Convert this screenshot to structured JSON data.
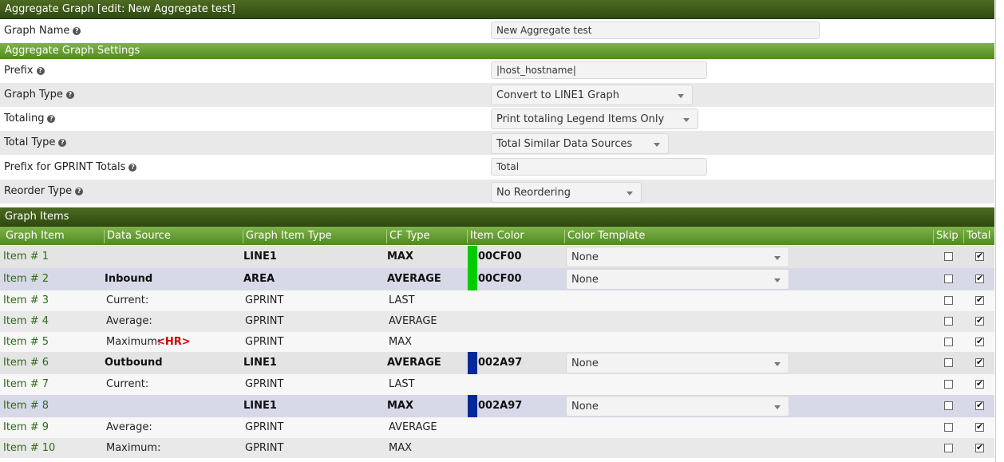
{
  "header": {
    "title": "Aggregate Graph [edit: New Aggregate test]"
  },
  "graph_name": {
    "label": "Graph Name",
    "value": "New Aggregate test"
  },
  "settings": {
    "title": "Aggregate Graph Settings",
    "prefix": {
      "label": "Prefix",
      "value": "|host_hostname|"
    },
    "graph_type": {
      "label": "Graph Type",
      "value": "Convert to LINE1 Graph"
    },
    "totaling": {
      "label": "Totaling",
      "value": "Print totaling Legend Items Only"
    },
    "total_type": {
      "label": "Total Type",
      "value": "Total Similar Data Sources"
    },
    "gprint_prefix": {
      "label": "Prefix for GPRINT Totals",
      "value": "Total"
    },
    "reorder_type": {
      "label": "Reorder Type",
      "value": "No Reordering"
    }
  },
  "items_section": {
    "title": "Graph Items",
    "columns": [
      "Graph Item",
      "Data Source",
      "Graph Item Type",
      "CF Type",
      "Item Color",
      "Color Template",
      "Skip",
      "Total"
    ],
    "rows": [
      {
        "name": "Item # 1",
        "source": "",
        "type": "LINE1",
        "cf": "MAX",
        "color": "00CF00",
        "swatch": "#00cc00",
        "template": "None",
        "skip": false,
        "total": true
      },
      {
        "name": "Item # 2",
        "source": "Inbound",
        "type": "AREA",
        "cf": "AVERAGE",
        "color": "00CF00",
        "swatch": "#00cc00",
        "template": "None",
        "skip": false,
        "total": true
      },
      {
        "name": "Item # 3",
        "source": "Current:",
        "type": "GPRINT",
        "cf": "LAST",
        "skip": false,
        "total": true
      },
      {
        "name": "Item # 4",
        "source": "Average:",
        "type": "GPRINT",
        "cf": "AVERAGE",
        "skip": false,
        "total": true
      },
      {
        "name": "Item # 5",
        "source": "Maximum:",
        "source_extra": "<HR>",
        "type": "GPRINT",
        "cf": "MAX",
        "skip": false,
        "total": true
      },
      {
        "name": "Item # 6",
        "source": "Outbound",
        "type": "LINE1",
        "cf": "AVERAGE",
        "color": "002A97",
        "swatch": "#002a97",
        "template": "None",
        "skip": false,
        "total": true
      },
      {
        "name": "Item # 7",
        "source": "Current:",
        "type": "GPRINT",
        "cf": "LAST",
        "skip": false,
        "total": true
      },
      {
        "name": "Item # 8",
        "source": "",
        "type": "LINE1",
        "cf": "MAX",
        "color": "002A97",
        "swatch": "#002a97",
        "template": "None",
        "skip": false,
        "total": true
      },
      {
        "name": "Item # 9",
        "source": "Average:",
        "type": "GPRINT",
        "cf": "AVERAGE",
        "skip": false,
        "total": true
      },
      {
        "name": "Item # 10",
        "source": "Maximum:",
        "type": "GPRINT",
        "cf": "MAX",
        "skip": false,
        "total": true
      }
    ]
  }
}
